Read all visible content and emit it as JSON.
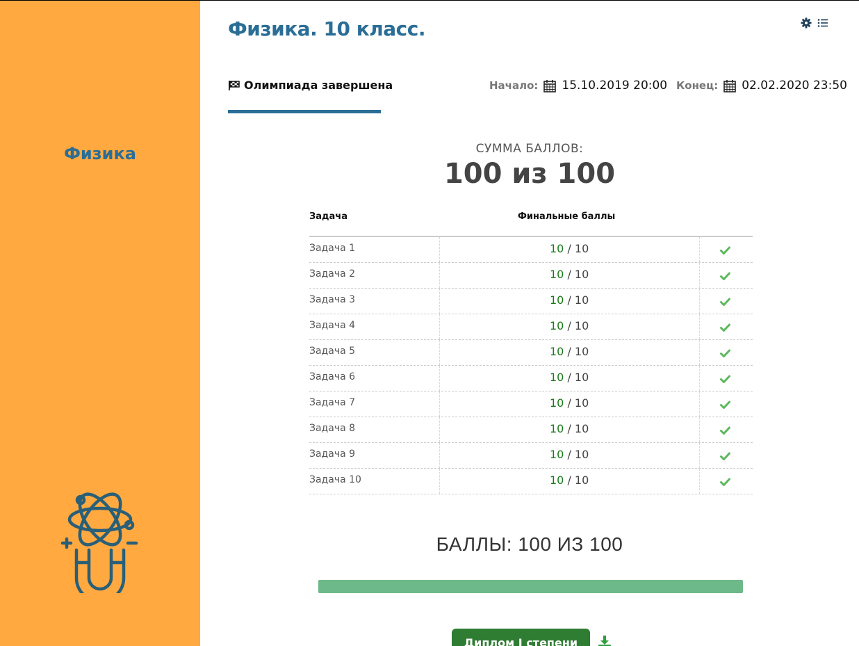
{
  "sidebar": {
    "subject": "Физика",
    "logo_icon": "atom-magnet-icon"
  },
  "header": {
    "title": "Физика. 10 класс.",
    "icons": [
      "gear-icon",
      "list-icon"
    ]
  },
  "olympiad": {
    "status": "Олимпиада завершена",
    "status_icon": "flag-checkered-icon",
    "start_label": "Начало:",
    "start_value": "15.10.2019 20:00",
    "end_label": "Конец:",
    "end_value": "02.02.2020 23:50"
  },
  "summary": {
    "label": "СУММА БАЛЛОВ:",
    "value": "100 из 100"
  },
  "table": {
    "headers": {
      "task": "Задача",
      "final": "Финальные баллы"
    },
    "rows": [
      {
        "task": "Задача 1",
        "score": "10",
        "max": "/ 10"
      },
      {
        "task": "Задача 2",
        "score": "10",
        "max": "/ 10"
      },
      {
        "task": "Задача 3",
        "score": "10",
        "max": "/ 10"
      },
      {
        "task": "Задача 4",
        "score": "10",
        "max": "/ 10"
      },
      {
        "task": "Задача 5",
        "score": "10",
        "max": "/ 10"
      },
      {
        "task": "Задача 6",
        "score": "10",
        "max": "/ 10"
      },
      {
        "task": "Задача 7",
        "score": "10",
        "max": "/ 10"
      },
      {
        "task": "Задача 8",
        "score": "10",
        "max": "/ 10"
      },
      {
        "task": "Задача 9",
        "score": "10",
        "max": "/ 10"
      },
      {
        "task": "Задача 10",
        "score": "10",
        "max": "/ 10"
      }
    ]
  },
  "points": {
    "title": "БАЛЛЫ: 100 ИЗ 100",
    "progress_percent": 100
  },
  "diploma": {
    "button_label": "Диплом I степени",
    "download_icon": "download-icon"
  },
  "colors": {
    "sidebar": "#FFA940",
    "accent": "#2A6E96",
    "progress": "#6DB98A",
    "success": "#5CB85C",
    "button": "#2E7D32"
  }
}
